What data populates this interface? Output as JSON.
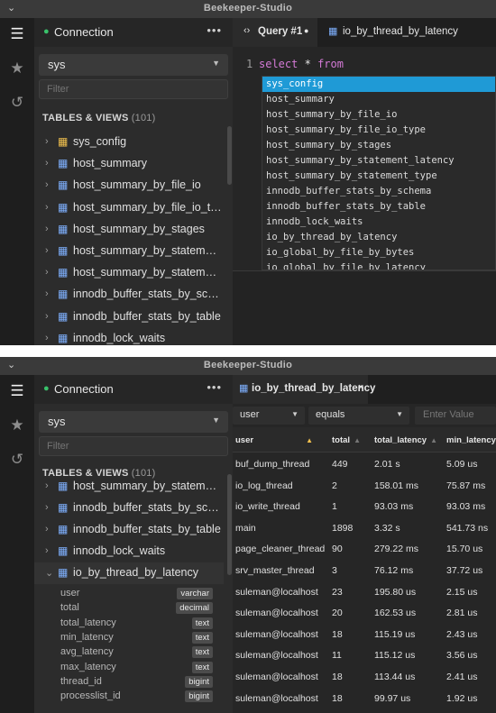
{
  "app_title": "Beekeeper-Studio",
  "top": {
    "connection_label": "Connection",
    "more_label": "•••",
    "database": "sys",
    "filter_placeholder": "Filter",
    "section_title": "TABLES & VIEWS",
    "section_count": "(101)",
    "tables": [
      "sys_config",
      "host_summary",
      "host_summary_by_file_io",
      "host_summary_by_file_io_type",
      "host_summary_by_stages",
      "host_summary_by_statemen...",
      "host_summary_by_statemen...",
      "innodb_buffer_stats_by_sche...",
      "innodb_buffer_stats_by_table",
      "innodb_lock_waits"
    ],
    "tabs": [
      {
        "label": "Query #1",
        "icon": "code-icon"
      },
      {
        "label": "io_by_thread_by_latency",
        "icon": "table-icon"
      }
    ],
    "modified_dot": "●",
    "line_number": "1",
    "code_keyword1": "select",
    "code_star": "*",
    "code_keyword2": "from",
    "autocomplete": [
      "sys_config",
      "host_summary",
      "host_summary_by_file_io",
      "host_summary_by_file_io_type",
      "host_summary_by_stages",
      "host_summary_by_statement_latency",
      "host_summary_by_statement_type",
      "innodb_buffer_stats_by_schema",
      "innodb_buffer_stats_by_table",
      "innodb_lock_waits",
      "io_by_thread_by_latency",
      "io_global_by_file_by_bytes",
      "io_global_by_file_by_latency"
    ]
  },
  "bottom": {
    "connection_label": "Connection",
    "more_label": "•••",
    "database": "sys",
    "filter_placeholder": "Filter",
    "section_title": "TABLES & VIEWS",
    "section_count": "(101)",
    "tables": [
      "host_summary_by_statemen...",
      "innodb_buffer_stats_by_sche...",
      "innodb_buffer_stats_by_table",
      "innodb_lock_waits",
      "io_by_thread_by_latency"
    ],
    "columns": [
      {
        "name": "user",
        "type": "varchar"
      },
      {
        "name": "total",
        "type": "decimal"
      },
      {
        "name": "total_latency",
        "type": "text"
      },
      {
        "name": "min_latency",
        "type": "text"
      },
      {
        "name": "avg_latency",
        "type": "text"
      },
      {
        "name": "max_latency",
        "type": "text"
      },
      {
        "name": "thread_id",
        "type": "bigint"
      },
      {
        "name": "processlist_id",
        "type": "bigint"
      }
    ],
    "tab_label": "io_by_thread_by_latency",
    "tab_close": "×",
    "filter_column": "user",
    "filter_operator": "equals",
    "filter_value_placeholder": "Enter Value",
    "headers": [
      "user",
      "total",
      "total_latency",
      "min_latency"
    ],
    "rows": [
      [
        "buf_dump_thread",
        "449",
        "2.01 s",
        "5.09 us"
      ],
      [
        "io_log_thread",
        "2",
        "158.01 ms",
        "75.87 ms"
      ],
      [
        "io_write_thread",
        "1",
        "93.03 ms",
        "93.03 ms"
      ],
      [
        "main",
        "1898",
        "3.32 s",
        "541.73 ns"
      ],
      [
        "page_cleaner_thread",
        "90",
        "279.22 ms",
        "15.70 us"
      ],
      [
        "srv_master_thread",
        "3",
        "76.12 ms",
        "37.72 us"
      ],
      [
        "suleman@localhost",
        "23",
        "195.80 us",
        "2.15 us"
      ],
      [
        "suleman@localhost",
        "20",
        "162.53 us",
        "2.81 us"
      ],
      [
        "suleman@localhost",
        "18",
        "115.19 us",
        "2.43 us"
      ],
      [
        "suleman@localhost",
        "11",
        "115.12 us",
        "3.56 us"
      ],
      [
        "suleman@localhost",
        "18",
        "113.44 us",
        "2.41 us"
      ],
      [
        "suleman@localhost",
        "18",
        "99.97 us",
        "1.92 us"
      ]
    ]
  },
  "colors": {
    "accent": "#1f9ad6",
    "connected": "#39c26b",
    "table_icon": "#7fb1ff",
    "view_icon": "#f2c14e",
    "keyword": "#d47ad7"
  }
}
